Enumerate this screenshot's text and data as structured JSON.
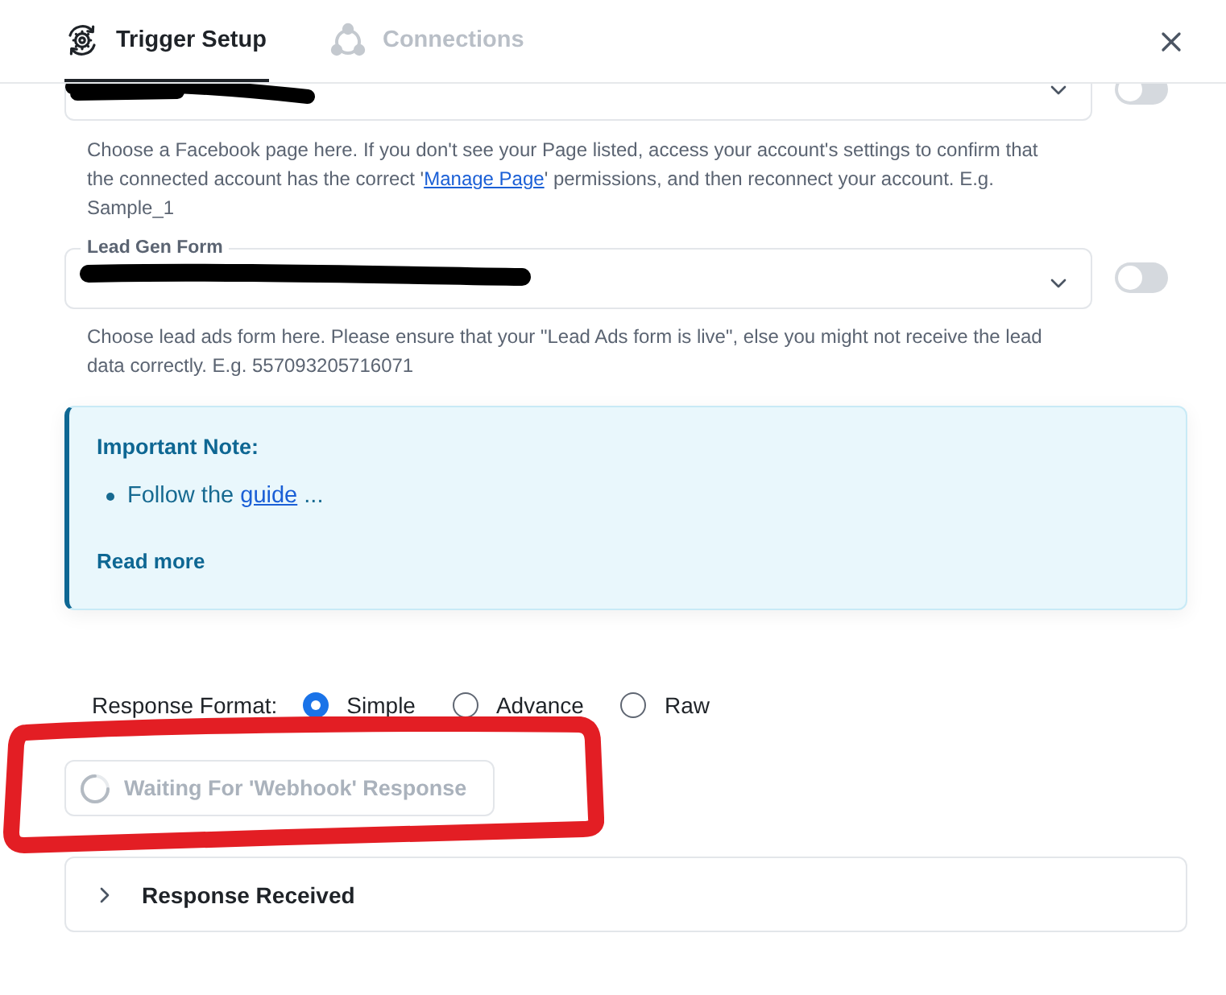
{
  "tabs": [
    {
      "kind": "trigger",
      "label": "Trigger Setup",
      "selected": true
    },
    {
      "kind": "connections",
      "label": "Connections",
      "selected": false
    }
  ],
  "fields": [
    {
      "redacted": true,
      "toggle": {
        "on": false
      },
      "help": [
        {
          "text": "Choose a Facebook page here. If you don't see your Page listed, access your account's settings to confirm that the connected account has the correct '"
        },
        {
          "text": "Manage Page",
          "link": true
        },
        {
          "text": "' permissions, and then reconnect your account. E.g. Sample_1"
        }
      ]
    },
    {
      "label": "Lead Gen Form",
      "redacted": true,
      "toggle": {
        "on": false
      },
      "help": [
        {
          "text": "Choose lead ads form here. Please ensure that your \"Lead Ads form is live\", else you might not receive the lead data correctly. E.g. 557093205716071"
        }
      ]
    }
  ],
  "note": {
    "title": "Important Note:",
    "items": [
      {
        "parts": [
          {
            "text": "Follow the "
          },
          {
            "text": "guide",
            "link": true
          },
          {
            "text": " ..."
          }
        ]
      }
    ],
    "read_more": "Read more"
  },
  "response_format": {
    "label": "Response Format:",
    "options": [
      {
        "label": "Simple",
        "selected": true
      },
      {
        "label": "Advance",
        "selected": false
      },
      {
        "label": "Raw",
        "selected": false
      }
    ]
  },
  "wait_button": {
    "label": "Waiting For 'Webhook' Response",
    "disabled": true,
    "loading": true
  },
  "accordion": {
    "label": "Response Received",
    "expanded": false
  }
}
